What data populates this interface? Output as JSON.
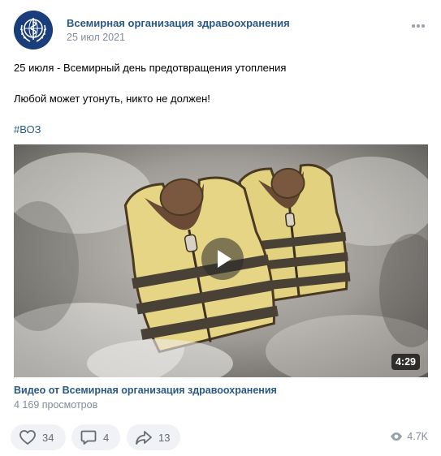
{
  "post": {
    "author": "Всемирная организация здравоохранения",
    "date": "25 июл 2021",
    "text_lines": [
      "25 июля - Всемирный день предотвращения утопления",
      "Любой может утонуть, никто не должен!"
    ],
    "hashtag": "#ВОЗ"
  },
  "video": {
    "duration": "4:29",
    "title": "Видео от Всемирная организация здравоохранения",
    "views_text": "4 169 просмотров"
  },
  "actions": {
    "likes": "34",
    "comments": "4",
    "shares": "13",
    "views": "4.7K"
  },
  "icons": {
    "avatar": "who-emblem-icon",
    "more": "more-dots-icon",
    "like": "heart-icon",
    "comment": "comment-icon",
    "share": "share-arrow-icon",
    "play": "play-icon",
    "views": "eye-icon"
  },
  "colors": {
    "link": "#2a5885",
    "secondary": "#818c99",
    "pill_bg": "#f0f2f5",
    "avatar_bg": "#1a3e7b"
  }
}
